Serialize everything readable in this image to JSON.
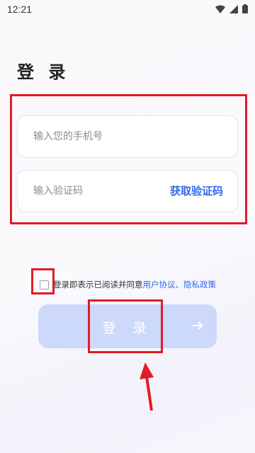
{
  "status": {
    "time": "12:21"
  },
  "page": {
    "title": "登 录"
  },
  "form": {
    "phone_placeholder": "输入您的手机号",
    "code_placeholder": "输入验证码",
    "get_code_label": "获取验证码"
  },
  "agreement": {
    "text": "登录即表示已阅读并同意",
    "user_agreement": "用户协议",
    "separator": "、",
    "privacy_policy": "隐私政策"
  },
  "login": {
    "label": "登 录"
  },
  "colors": {
    "accent": "#2f6af0",
    "annotation": "#e01c24",
    "button_bg": "#cdd9fb"
  }
}
